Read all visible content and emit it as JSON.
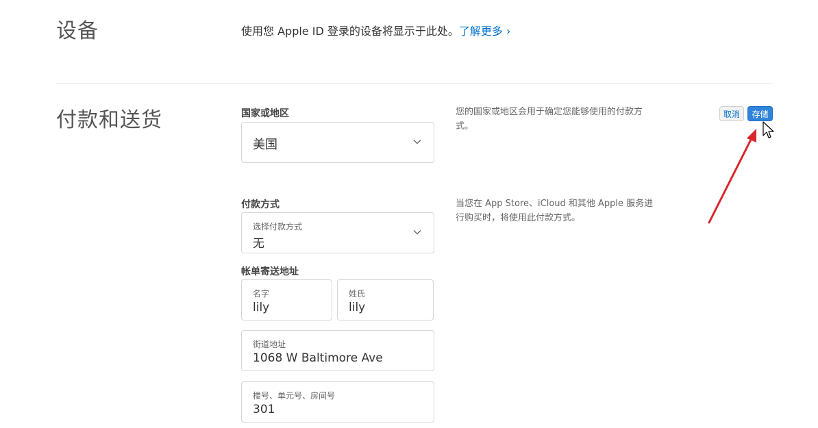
{
  "devices": {
    "title": "设备",
    "description": "使用您 Apple ID 登录的设备将显示于此处。",
    "learn_more": "了解更多 ›"
  },
  "payment_shipping": {
    "title": "付款和送货",
    "cancel_label": "取消",
    "save_label": "存储",
    "country": {
      "label": "国家或地区",
      "value": "美国",
      "help": "您的国家或地区会用于确定您能够使用的付款方式。"
    },
    "payment_method": {
      "label": "付款方式",
      "sublabel": "选择付款方式",
      "value": "无",
      "help": "当您在 App Store、iCloud 和其他 Apple 服务进行购买时，将使用此付款方式。"
    },
    "billing_address": {
      "label": "帐单寄送地址",
      "first_name_label": "名字",
      "first_name_value": "lily",
      "last_name_label": "姓氏",
      "last_name_value": "lily",
      "street_label": "街道地址",
      "street_value": "1068 W Baltimore Ave",
      "unit_label": "楼号、单元号、房间号",
      "unit_value": "301"
    }
  },
  "colors": {
    "link": "#0070c9",
    "save_button": "#2f84da",
    "annotation_arrow": "#d9262b"
  }
}
